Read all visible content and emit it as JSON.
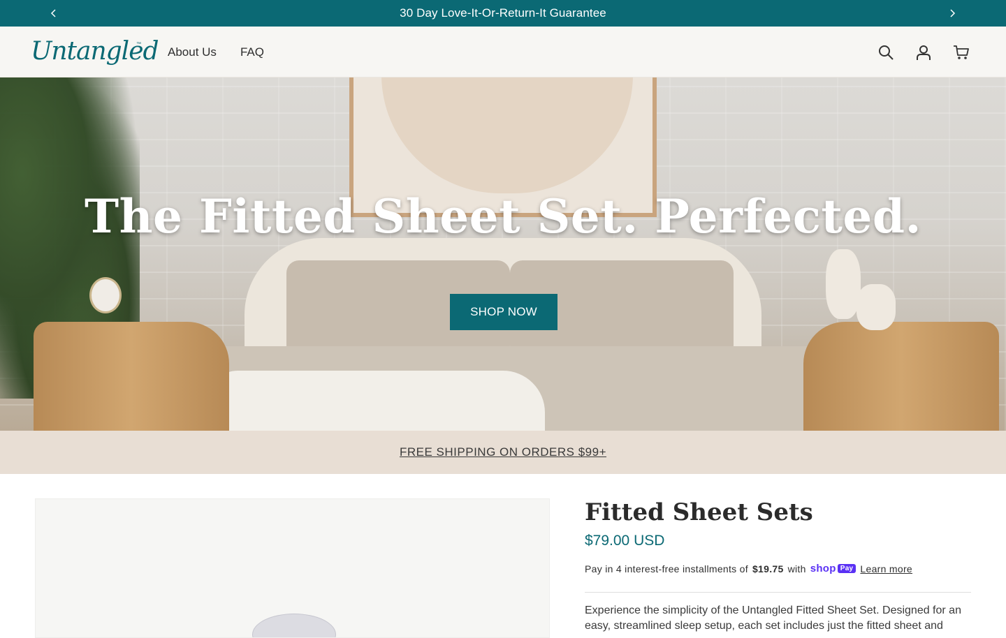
{
  "announcement": {
    "message": "30 Day Love-It-Or-Return-It Guarantee",
    "prev_icon": "chevron-left-icon",
    "next_icon": "chevron-right-icon"
  },
  "header": {
    "logo_text": "Untangled",
    "logo_tm": "™",
    "nav": [
      {
        "label": "About Us"
      },
      {
        "label": "FAQ"
      }
    ],
    "icons": [
      "search-icon",
      "account-icon",
      "cart-icon"
    ]
  },
  "hero": {
    "title": "The Fitted Sheet Set. Perfected.",
    "button_label": "SHOP NOW"
  },
  "shipping_banner": {
    "text": "FREE SHIPPING ON ORDERS $99+"
  },
  "product": {
    "title": "Fitted Sheet Sets",
    "price": "$79.00 USD",
    "installments_prefix": "Pay in 4 interest-free installments of",
    "installment_amount": "$19.75",
    "installments_with": "with",
    "shop_label": "shop",
    "pay_label": "Pay",
    "learn_more": "Learn more",
    "description": "Experience the simplicity of the Untangled Fitted Sheet Set. Designed for an easy, streamlined sleep setup, each set includes just the fitted sheet and"
  },
  "colors": {
    "brand_teal": "#0b6974",
    "banner_beige": "#e8ded4",
    "header_bg": "#f7f6f3"
  }
}
